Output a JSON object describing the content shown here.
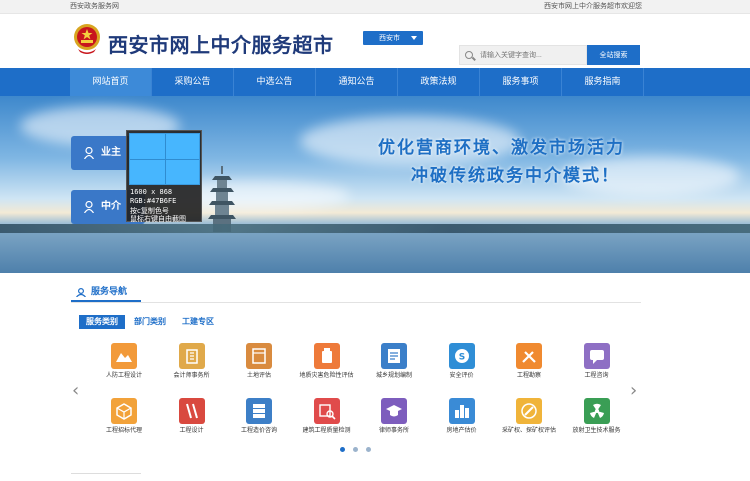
{
  "topbar": {
    "left": "西安政务服务网",
    "right": "西安市网上中介服务超市欢迎您"
  },
  "header": {
    "title": "西安市网上中介服务超市",
    "city_select": "西安市",
    "search_placeholder": "请输入关键字查询...",
    "search_button": "全站搜索"
  },
  "nav": [
    {
      "label": "网站首页",
      "active": true
    },
    {
      "label": "采购公告"
    },
    {
      "label": "中选公告"
    },
    {
      "label": "通知公告"
    },
    {
      "label": "政策法规"
    },
    {
      "label": "服务事项"
    },
    {
      "label": "服务指南"
    }
  ],
  "banner": {
    "slogan1": "优化营商环境、激发市场活力",
    "slogan2": "冲破传统政务中介模式！",
    "role_owner": "业主",
    "role_agent": "中介"
  },
  "tooltip": {
    "size": "1600 x 868",
    "rgb": "RGB:#47B6FE",
    "copy_hint": "按c复制色号",
    "drag_hint": "鼠标右键自由截图",
    "preview_color": "#47b6fe"
  },
  "services": {
    "section_title": "服务导航",
    "tabs": [
      {
        "label": "服务类别",
        "active": true
      },
      {
        "label": "部门类别"
      },
      {
        "label": "工建专区"
      }
    ],
    "items": [
      {
        "label": "人防工程设计",
        "color": "#f29a3a",
        "icon": "mountain"
      },
      {
        "label": "会计师事务所",
        "color": "#e0a94a",
        "icon": "building"
      },
      {
        "label": "土地评估",
        "color": "#d98b3f",
        "icon": "frame"
      },
      {
        "label": "地质灾害危险性评估",
        "color": "#ee7a3a",
        "icon": "bottle"
      },
      {
        "label": "城乡规划编制",
        "color": "#3b7fc9",
        "icon": "document"
      },
      {
        "label": "安全评价",
        "color": "#2f8ed6",
        "icon": "shield"
      },
      {
        "label": "工程勘察",
        "color": "#f08a30",
        "icon": "tools"
      },
      {
        "label": "工程咨询",
        "color": "#8e6fc4",
        "icon": "chat"
      },
      {
        "label": "工程招标代理",
        "color": "#f2a23a",
        "icon": "box"
      },
      {
        "label": "工程设计",
        "color": "#d9493f",
        "icon": "ruler"
      },
      {
        "label": "工程造价咨询",
        "color": "#3d7fc7",
        "icon": "server"
      },
      {
        "label": "建筑工程质量检测",
        "color": "#e04b4b",
        "icon": "inspect"
      },
      {
        "label": "律师事务所",
        "color": "#7d5dbd",
        "icon": "cap"
      },
      {
        "label": "房地产估价",
        "color": "#3a8bd6",
        "icon": "city"
      },
      {
        "label": "采矿权、探矿权评估",
        "color": "#f0b43a",
        "icon": "pickaxe"
      },
      {
        "label": "放射卫生技术服务",
        "color": "#3a9e55",
        "icon": "radiation"
      }
    ]
  }
}
